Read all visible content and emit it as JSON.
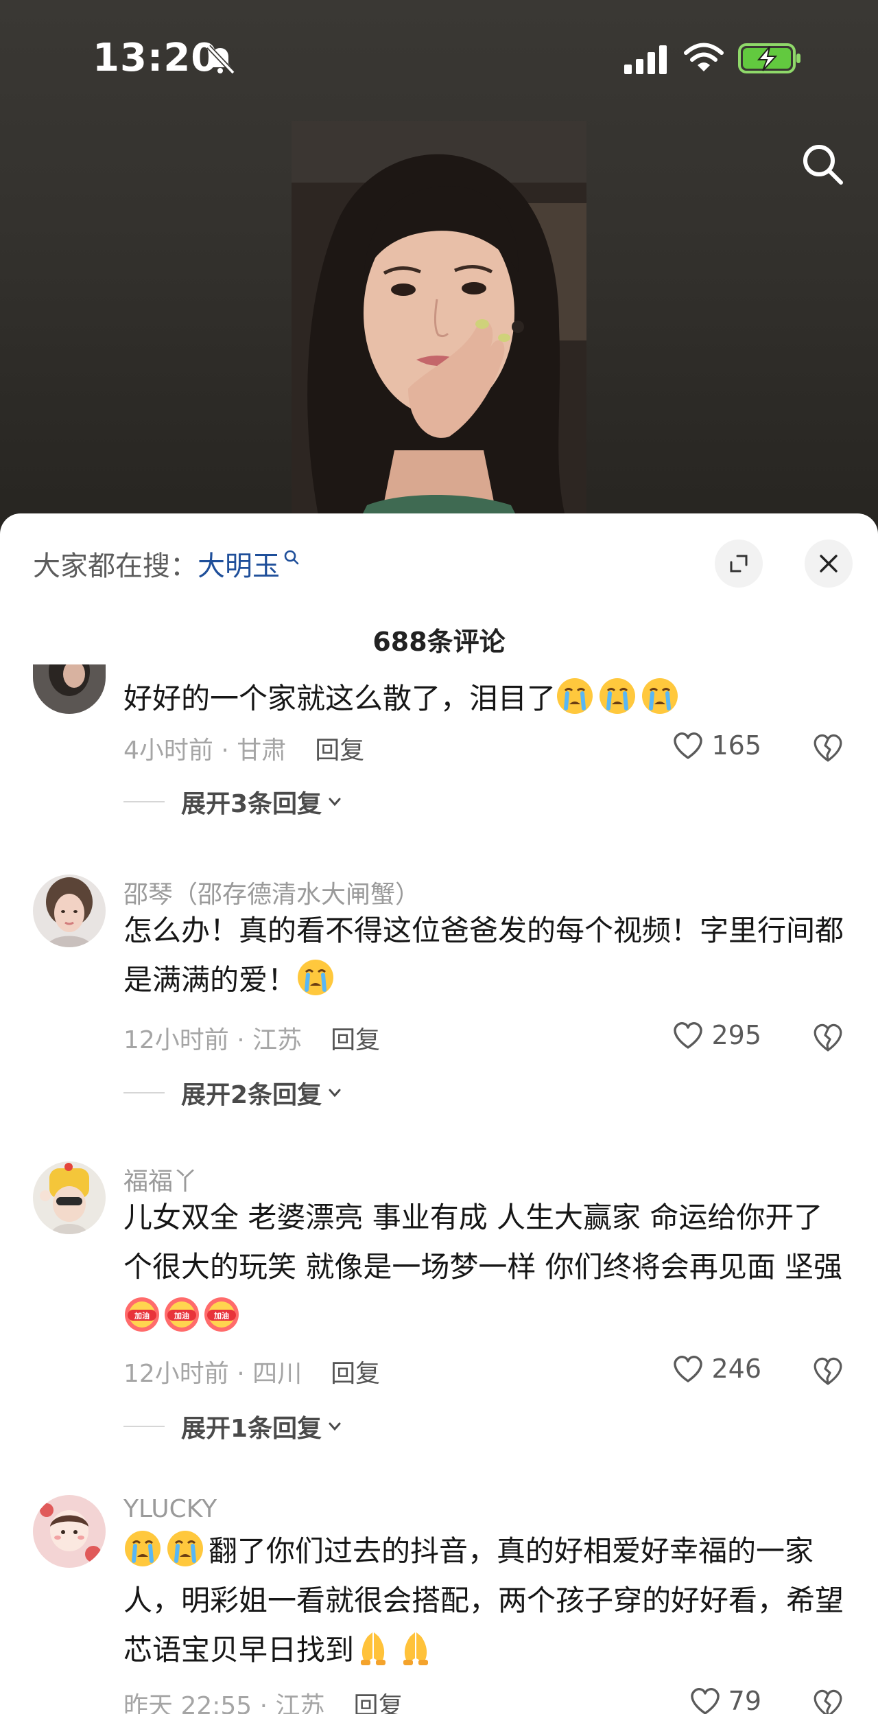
{
  "status_bar": {
    "time": "13:20",
    "icons": [
      "bell-muted-icon",
      "cellular-signal-icon",
      "wifi-icon",
      "battery-charging-icon"
    ]
  },
  "top": {
    "search_icon": "search-icon"
  },
  "sheet": {
    "hot_search_prefix": "大家都在搜：",
    "hot_search_term": "大明玉",
    "expand_icon": "expand-icon",
    "close_icon": "close-icon",
    "comment_count": "688条评论"
  },
  "comments": [
    {
      "name": "",
      "text": "好好的一个家就这么散了，泪目了",
      "emojis": [
        "crying-emoji",
        "crying-emoji",
        "crying-emoji"
      ],
      "time_location": "4小时前 · 甘肃",
      "reply_label": "回复",
      "likes": "165",
      "expand_label": "展开3条回复"
    },
    {
      "name": "邵琴（邵存德清水大闸蟹）",
      "text": "怎么办！真的看不得这位爸爸发的每个视频！字里行间都是满满的爱！",
      "emojis": [
        "crying-emoji"
      ],
      "time_location": "12小时前 · 江苏",
      "reply_label": "回复",
      "likes": "295",
      "expand_label": "展开2条回复"
    },
    {
      "name": "福福丫",
      "text": "儿女双全 老婆漂亮 事业有成 人生大赢家 命运给你开了个很大的玩笑 就像是一场梦一样 你们终将会再见面 坚强",
      "emojis": [
        "jiayou-emoji",
        "jiayou-emoji",
        "jiayou-emoji"
      ],
      "emoji_text": "加油",
      "time_location": "12小时前 · 四川",
      "reply_label": "回复",
      "likes": "246",
      "expand_label": "展开1条回复"
    },
    {
      "name": "YLUCKY",
      "text": "翻了你们过去的抖音，真的好相爱好幸福的一家人，明彩姐一看就很会搭配，两个孩子穿的好好看，希望芯语宝贝早日找到",
      "emojis_before": [
        "crying-emoji",
        "crying-emoji"
      ],
      "emojis": [
        "pray-emoji",
        "pray-emoji"
      ],
      "time_location": "昨天 22:55 · 江苏",
      "reply_label": "回复",
      "likes": "79"
    }
  ],
  "colors": {
    "accent_link": "#1f4f9a",
    "muted_text": "#a5a5a5",
    "sheet_bg": "#ffffff",
    "video_bg": "#34322e"
  }
}
